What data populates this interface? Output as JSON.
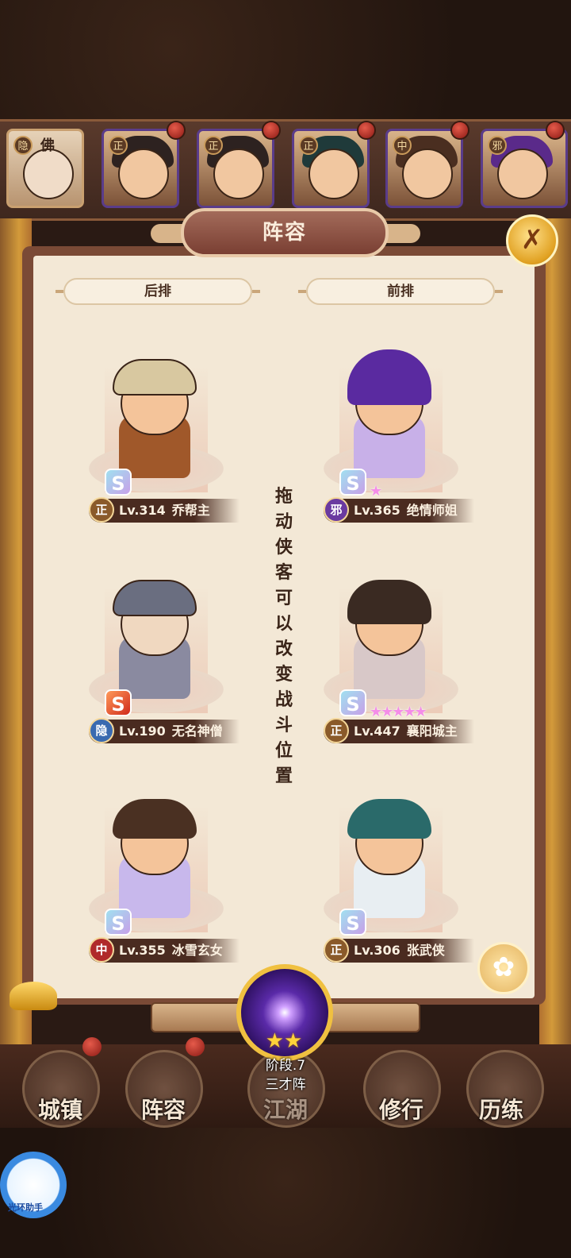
{
  "title": "阵容",
  "close_icon": "✗",
  "hero_strip": [
    {
      "faction": "隐",
      "label": "佛"
    },
    {
      "faction": "正",
      "label": ""
    },
    {
      "faction": "正",
      "label": ""
    },
    {
      "faction": "正",
      "label": ""
    },
    {
      "faction": "中",
      "label": ""
    },
    {
      "faction": "邪",
      "label": ""
    }
  ],
  "headers": {
    "back": "后排",
    "front": "前排"
  },
  "hint": "拖动侠客可以改变战斗位置",
  "characters": [
    {
      "faction": "正",
      "level": "Lv.314",
      "name": "乔帮主",
      "stars": ""
    },
    {
      "faction": "邪",
      "level": "Lv.365",
      "name": "绝情师姐",
      "stars": "★"
    },
    {
      "faction": "隐",
      "level": "Lv.190",
      "name": "无名神僧",
      "stars": ""
    },
    {
      "faction": "正",
      "level": "Lv.447",
      "name": "襄阳城主",
      "stars": "★★★★★"
    },
    {
      "faction": "中",
      "level": "Lv.355",
      "name": "冰雪玄女",
      "stars": ""
    },
    {
      "faction": "正",
      "level": "Lv.306",
      "name": "张武侠",
      "stars": ""
    }
  ],
  "formation": {
    "stars": "★★",
    "stage": "阶段.7",
    "name": "三才阵"
  },
  "nav": [
    {
      "label": "城镇"
    },
    {
      "label": "阵容"
    },
    {
      "label": "江湖"
    },
    {
      "label": "修行"
    },
    {
      "label": "历练"
    }
  ],
  "assistant": {
    "label": "光环助手"
  },
  "colors": {
    "zheng": "#8a5a2a",
    "xie": "#6a3aa0",
    "yin": "#3a6ab0",
    "zhong": "#b02a2a"
  }
}
